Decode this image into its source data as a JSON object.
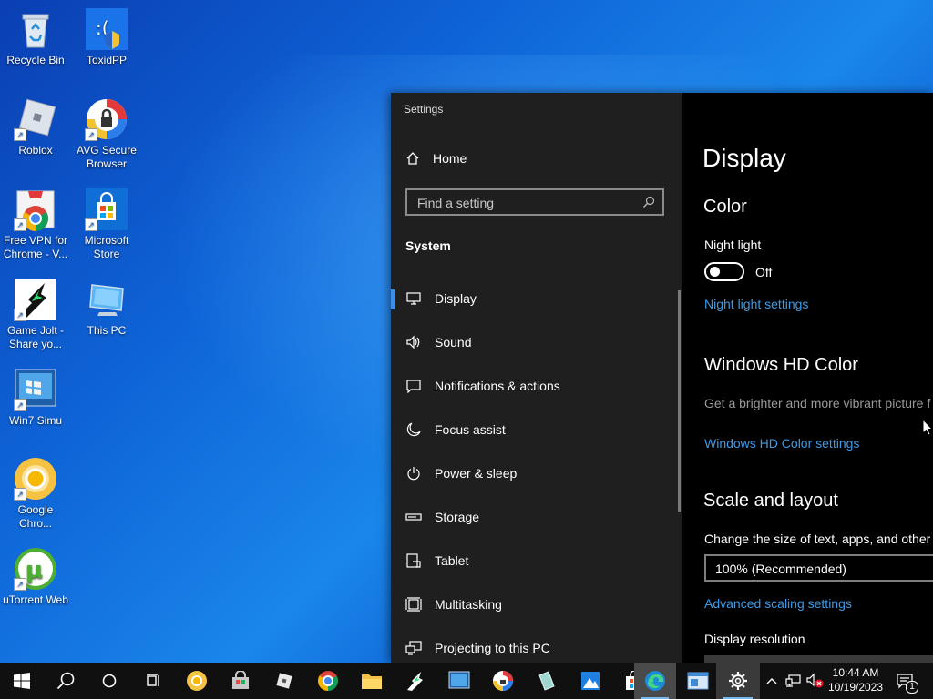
{
  "desktop": {
    "icons": [
      {
        "name": "recycle-bin",
        "label": "Recycle Bin"
      },
      {
        "name": "toxidpp",
        "label": "ToxidPP"
      },
      {
        "name": "roblox",
        "label": "Roblox"
      },
      {
        "name": "avg-secure-browser",
        "label": "AVG Secure Browser"
      },
      {
        "name": "free-vpn",
        "label": "Free VPN for Chrome - V..."
      },
      {
        "name": "microsoft-store",
        "label": "Microsoft Store"
      },
      {
        "name": "game-jolt",
        "label": "Game Jolt - Share yo..."
      },
      {
        "name": "this-pc",
        "label": "This PC"
      },
      {
        "name": "win7-simu",
        "label": "Win7 Simu"
      },
      {
        "name": "google-chrome",
        "label": "Google Chro..."
      },
      {
        "name": "utorrent-web",
        "label": "uTorrent Web"
      }
    ]
  },
  "settings": {
    "window_title": "Settings",
    "home_label": "Home",
    "search_placeholder": "Find a setting",
    "section_label": "System",
    "nav_items": [
      {
        "label": "Display",
        "icon": "monitor-icon",
        "selected": true
      },
      {
        "label": "Sound",
        "icon": "speaker-icon"
      },
      {
        "label": "Notifications & actions",
        "icon": "notification-icon"
      },
      {
        "label": "Focus assist",
        "icon": "moon-icon"
      },
      {
        "label": "Power & sleep",
        "icon": "power-icon"
      },
      {
        "label": "Storage",
        "icon": "storage-icon"
      },
      {
        "label": "Tablet",
        "icon": "tablet-icon"
      },
      {
        "label": "Multitasking",
        "icon": "multitasking-icon"
      },
      {
        "label": "Projecting to this PC",
        "icon": "projecting-icon"
      }
    ],
    "content": {
      "page_title": "Display",
      "color_heading": "Color",
      "night_light_label": "Night light",
      "night_light_state": "Off",
      "night_light_settings_link": "Night light settings",
      "hd_color_heading": "Windows HD Color",
      "hd_color_desc": "Get a brighter and more vibrant picture f apps that support HDR.",
      "hd_color_link": "Windows HD Color settings",
      "scale_heading": "Scale and layout",
      "scale_desc": "Change the size of text, apps, and other i",
      "scale_value": "100% (Recommended)",
      "advanced_scaling_link": "Advanced scaling settings",
      "resolution_label": "Display resolution"
    }
  },
  "taskbar": {
    "clock_time": "10:44 AM",
    "clock_date": "10/19/2023",
    "notification_count": "1"
  },
  "colors": {
    "accent": "#3b8eea",
    "link": "#3d9ae8",
    "nav_bg": "#1f1f1f",
    "content_bg": "#000000",
    "taskbar_bg": "#101010"
  }
}
